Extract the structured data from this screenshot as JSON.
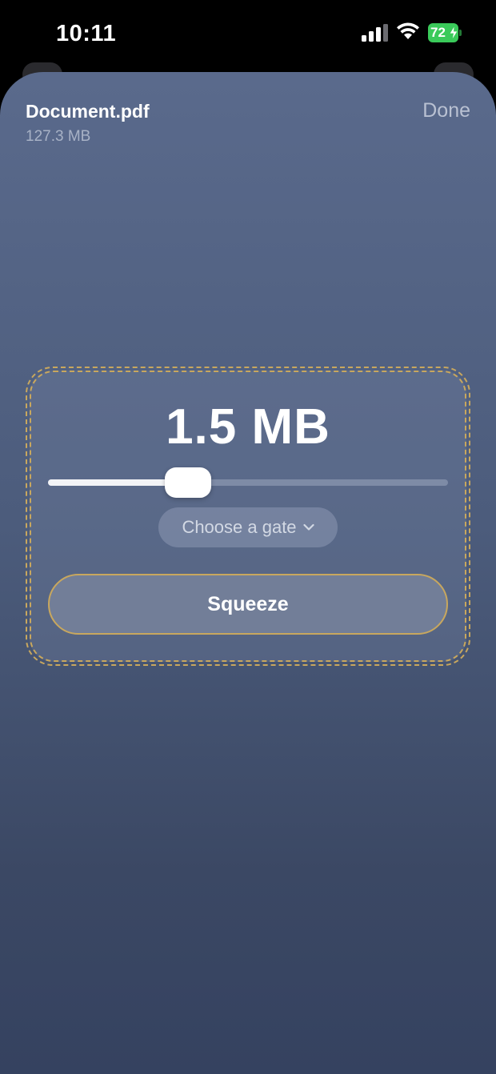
{
  "status_bar": {
    "time": "10:11",
    "battery_level": "72",
    "battery_color": "#3aca5a"
  },
  "header": {
    "file_name": "Document.pdf",
    "file_size": "127.3 MB",
    "done_label": "Done"
  },
  "compressor": {
    "target_size": "1.5 MB",
    "slider_fraction": 0.35,
    "gate_label": "Choose a gate",
    "squeeze_label": "Squeeze",
    "accent_color": "#c8a75e"
  }
}
